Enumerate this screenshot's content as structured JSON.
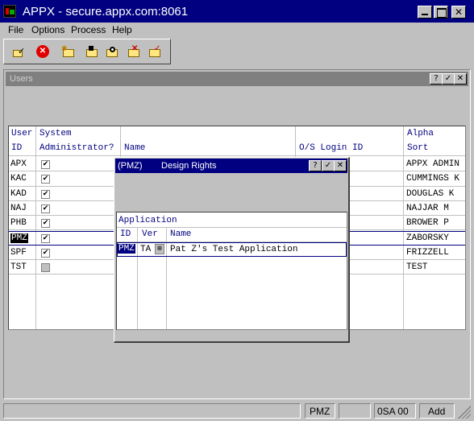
{
  "window": {
    "title": "APPX - secure.appx.com:8061",
    "controls": [
      "minimize-icon",
      "maximize-icon",
      "close-icon"
    ]
  },
  "menu": [
    "File",
    "Options",
    "Process",
    "Help"
  ],
  "toolbar": {
    "icons": [
      "ok-icon",
      "cancel-icon",
      "add-record-icon",
      "change-record-icon",
      "inquire-record-icon",
      "delete-record-icon",
      "remove-record-icon"
    ]
  },
  "users_frame": {
    "title": "Users",
    "headers": {
      "user_id_1": "User",
      "user_id_2": "ID",
      "sysadmin_1": "System",
      "sysadmin_2": "Administrator?",
      "name": "Name",
      "os_login": "O/S Login ID",
      "alpha_1": "Alpha",
      "alpha_2": "Sort"
    },
    "rows": [
      {
        "id": "APX",
        "admin": true,
        "alpha": "APPX ADMIN"
      },
      {
        "id": "KAC",
        "admin": true,
        "alpha": "CUMMINGS K"
      },
      {
        "id": "KAD",
        "admin": true,
        "alpha": "DOUGLAS K"
      },
      {
        "id": "NAJ",
        "admin": true,
        "alpha": "NAJJAR M"
      },
      {
        "id": "PHB",
        "admin": true,
        "alpha": "BROWER P"
      },
      {
        "id": "PMZ",
        "admin": true,
        "alpha": "ZABORSKY"
      },
      {
        "id": "SPF",
        "admin": true,
        "alpha": "FRIZZELL"
      },
      {
        "id": "TST",
        "admin": false,
        "alpha": "TEST"
      }
    ],
    "selected_index": 5
  },
  "design_rights": {
    "title_user": "(PMZ)",
    "title": "Design Rights",
    "section": "Application",
    "headers": {
      "id": "ID",
      "ver": "Ver",
      "name": "Name"
    },
    "rows": [
      {
        "id": "PMZ",
        "ver": "TA",
        "name": "Pat Z's Test Application"
      }
    ]
  },
  "status_bar": {
    "user": "PMZ",
    "database": "0SA 00",
    "mode": "Add"
  }
}
